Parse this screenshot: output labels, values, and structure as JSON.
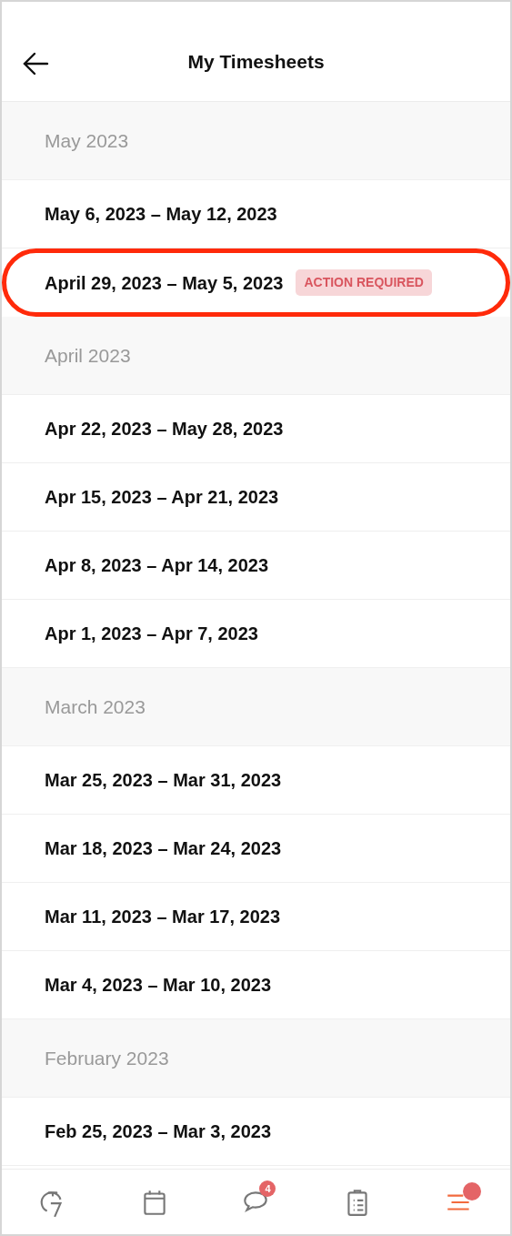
{
  "header": {
    "title": "My Timesheets"
  },
  "sections": [
    {
      "label": "May 2023",
      "rows": [
        {
          "period": "May 6, 2023 – May 12, 2023",
          "highlighted": false
        },
        {
          "period": "April 29, 2023 – May 5, 2023",
          "badge": "ACTION REQUIRED",
          "highlighted": true
        }
      ]
    },
    {
      "label": "April 2023",
      "rows": [
        {
          "period": "Apr 22, 2023 – May 28, 2023",
          "highlighted": false
        },
        {
          "period": "Apr 15, 2023 – Apr 21, 2023",
          "highlighted": false
        },
        {
          "period": "Apr 8, 2023 – Apr 14, 2023",
          "highlighted": false
        },
        {
          "period": "Apr 1, 2023 – Apr 7, 2023",
          "highlighted": false
        }
      ]
    },
    {
      "label": "March 2023",
      "rows": [
        {
          "period": "Mar 25, 2023 – Mar 31, 2023",
          "highlighted": false
        },
        {
          "period": "Mar 18, 2023 – Mar 24, 2023",
          "highlighted": false
        },
        {
          "period": "Mar 11, 2023 – Mar 17, 2023",
          "highlighted": false
        },
        {
          "period": "Mar 4, 2023 – Mar 10, 2023",
          "highlighted": false
        }
      ]
    },
    {
      "label": "February 2023",
      "rows": [
        {
          "period": "Feb 25, 2023 – Mar 3, 2023",
          "highlighted": false
        }
      ]
    }
  ],
  "tab_bar": [
    {
      "kind": "timer",
      "selected": false
    },
    {
      "kind": "calendar",
      "selected": false
    },
    {
      "kind": "chat",
      "selected": false,
      "badge": "4"
    },
    {
      "kind": "tasks",
      "selected": false
    },
    {
      "kind": "menu",
      "selected": true,
      "dot": true
    }
  ]
}
